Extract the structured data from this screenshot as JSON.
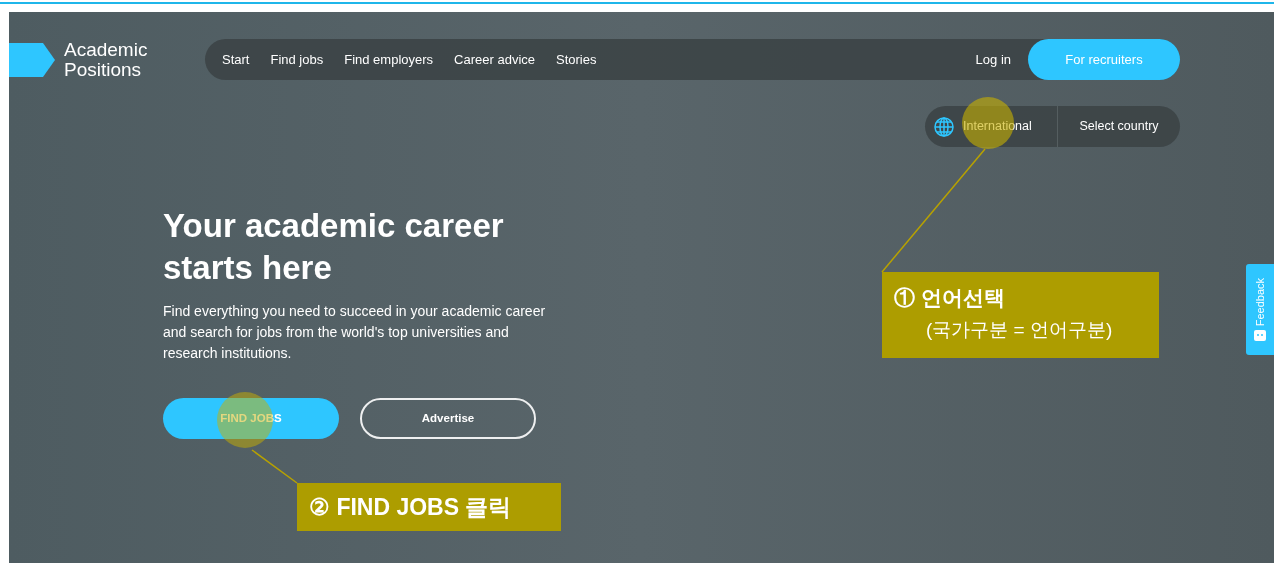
{
  "logo": {
    "text": "Academic Positions"
  },
  "nav": {
    "items": [
      {
        "label": "Start"
      },
      {
        "label": "Find jobs"
      },
      {
        "label": "Find employers"
      },
      {
        "label": "Career advice"
      },
      {
        "label": "Stories"
      }
    ],
    "login": "Log in",
    "recruiters": "For recruiters"
  },
  "region": {
    "current": "International",
    "select": "Select country"
  },
  "hero": {
    "title": "Your academic career starts here",
    "text": "Find everything you need to succeed in your academic career and search for jobs from the world's top universities and research institutions.",
    "buttons": [
      {
        "label": "FIND JOBS",
        "kind": "primary"
      },
      {
        "label": "Advertise",
        "kind": "outline"
      }
    ]
  },
  "feedback": {
    "label": "Feedback"
  },
  "annotations": [
    {
      "title": "① 언어선택",
      "note": "(국가구분 = 언어구분)"
    },
    {
      "title": "② FIND JOBS 클릭"
    }
  ]
}
